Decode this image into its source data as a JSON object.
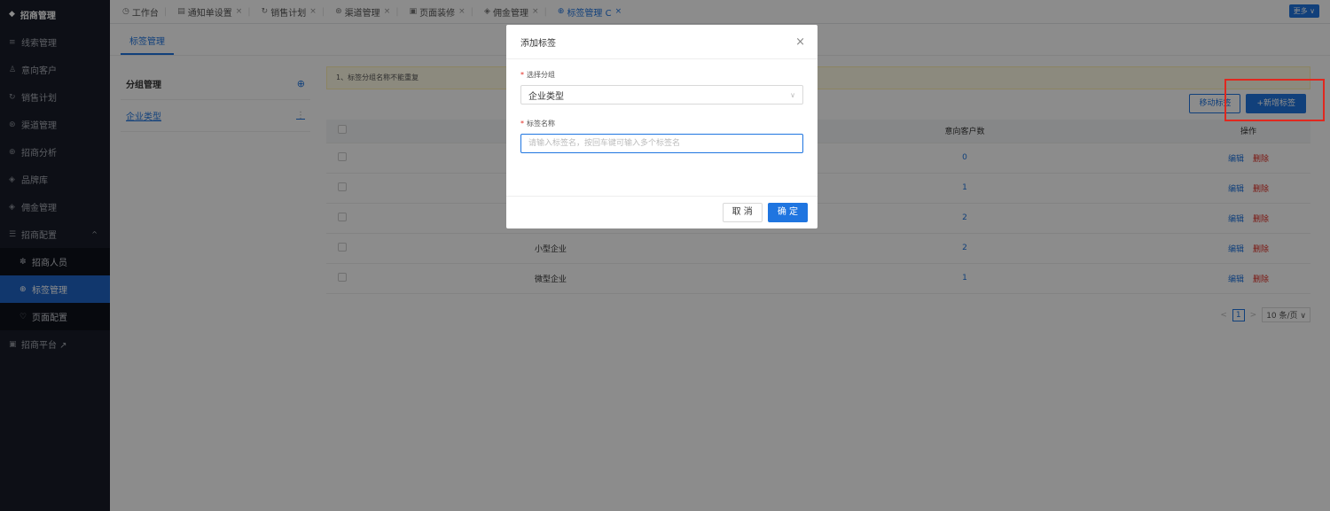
{
  "sidebar": {
    "logo": "招商管理",
    "items": [
      {
        "icon": "≡",
        "label": "线索管理"
      },
      {
        "icon": "♙",
        "label": "意向客户"
      },
      {
        "icon": "↻",
        "label": "销售计划"
      },
      {
        "icon": "⊛",
        "label": "渠道管理"
      },
      {
        "icon": "⊕",
        "label": "招商分析"
      },
      {
        "icon": "◈",
        "label": "品牌库"
      },
      {
        "icon": "◈",
        "label": "佣金管理"
      },
      {
        "icon": "☰",
        "label": "招商配置",
        "caret": "^"
      }
    ],
    "sub_items": [
      {
        "icon": "✽",
        "label": "招商人员"
      },
      {
        "icon": "⊕",
        "label": "标签管理"
      },
      {
        "icon": "♡",
        "label": "页面配置"
      }
    ],
    "platform": {
      "icon": "▣",
      "label": "招商平台 ↗"
    }
  },
  "tabbar": {
    "tabs": [
      {
        "icon": "◷",
        "label": "工作台",
        "close": ""
      },
      {
        "icon": "▤",
        "label": "通知单设置",
        "close": "×"
      },
      {
        "icon": "↻",
        "label": "销售计划",
        "close": "×"
      },
      {
        "icon": "⊛",
        "label": "渠道管理",
        "close": "×"
      },
      {
        "icon": "▣",
        "label": "页面装修",
        "close": "×"
      },
      {
        "icon": "◈",
        "label": "佣金管理",
        "close": "×"
      },
      {
        "icon": "⊕",
        "label": "标签管理 C",
        "close": "×"
      }
    ],
    "more": "更多 ∨"
  },
  "subtab": "标签管理",
  "left_panel": {
    "title": "分组管理",
    "add_icon": "⊕",
    "groups": [
      {
        "label": "企业类型",
        "menu": "⋮"
      }
    ]
  },
  "notice": "1、标签分组名称不能重复",
  "toolbar": {
    "move": "移动标签",
    "add": "+新增标签"
  },
  "table": {
    "headers": [
      "",
      "",
      "意向客户数",
      "操作"
    ],
    "rows": [
      {
        "name": "",
        "count": "0"
      },
      {
        "name": "",
        "count": "1"
      },
      {
        "name": "",
        "count": "2"
      },
      {
        "name": "小型企业",
        "count": "2"
      },
      {
        "name": "微型企业",
        "count": "1"
      }
    ],
    "edit": "编辑",
    "delete": "删除"
  },
  "pager": {
    "prev": "<",
    "page": "1",
    "next": ">",
    "size": "10 条/页 ∨"
  },
  "modal": {
    "title": "添加标签",
    "close": "×",
    "group_label": "选择分组",
    "group_value": "企业类型",
    "name_label": "标签名称",
    "name_placeholder": "请输入标签名，按回车键可输入多个标签名",
    "required": "*",
    "cancel": "取 消",
    "ok": "确 定"
  }
}
